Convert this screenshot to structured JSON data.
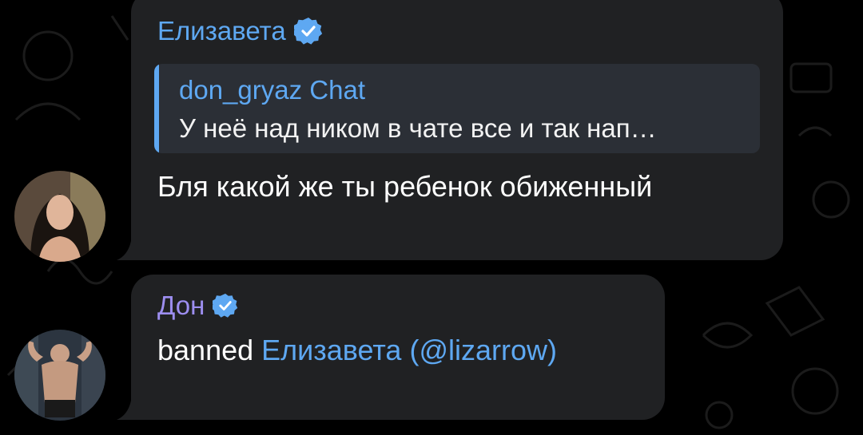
{
  "colors": {
    "background": "#000000",
    "bubble": "#202123",
    "reply_background": "#2b2f36",
    "accent_blue": "#5ea8f2",
    "name_purple": "#9d8ef0",
    "text": "#ffffff"
  },
  "messages": [
    {
      "sender": "Елизавета",
      "verified_icon": "verified-badge-icon",
      "reply": {
        "author": "don_gryaz Chat",
        "text": "У неё над ником в чате все и так нап…"
      },
      "text": "Бля какой же ты ребенок обиженный",
      "avatar": "avatar-woman"
    },
    {
      "sender": "Дон",
      "verified_icon": "verified-badge-icon",
      "text_prefix": "banned ",
      "mention_name": "Елизавета",
      "mention_open": " (",
      "mention_handle": "@lizarrow",
      "mention_close": ")",
      "avatar": "avatar-man"
    }
  ]
}
